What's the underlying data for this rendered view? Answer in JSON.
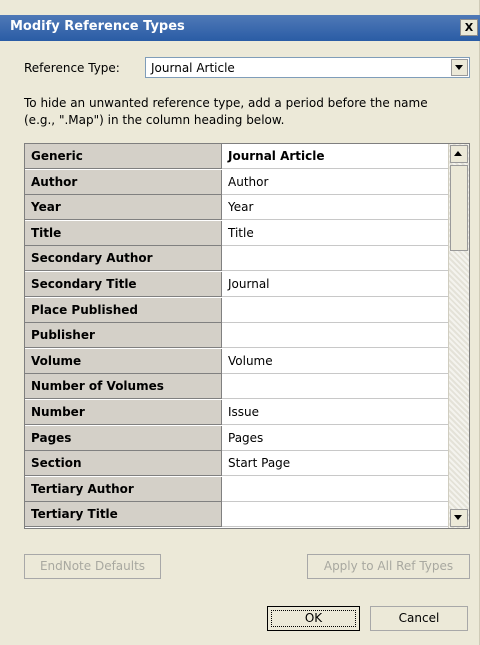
{
  "window": {
    "title": "Modify Reference Types",
    "close_glyph": "X"
  },
  "ref_type": {
    "label": "Reference Type:",
    "value": "Journal Article"
  },
  "instructions": {
    "line1": "To hide an unwanted reference type, add a period before the name",
    "line2": "(e.g., \".Map\") in the column heading below."
  },
  "table": {
    "rows": [
      {
        "field": "Generic",
        "value": "Journal Article"
      },
      {
        "field": "Author",
        "value": "Author"
      },
      {
        "field": "Year",
        "value": "Year"
      },
      {
        "field": "Title",
        "value": "Title"
      },
      {
        "field": "Secondary Author",
        "value": ""
      },
      {
        "field": "Secondary Title",
        "value": "Journal"
      },
      {
        "field": "Place Published",
        "value": ""
      },
      {
        "field": "Publisher",
        "value": ""
      },
      {
        "field": "Volume",
        "value": "Volume"
      },
      {
        "field": "Number of Volumes",
        "value": ""
      },
      {
        "field": "Number",
        "value": "Issue"
      },
      {
        "field": "Pages",
        "value": "Pages"
      },
      {
        "field": "Section",
        "value": "Start Page"
      },
      {
        "field": "Tertiary Author",
        "value": ""
      },
      {
        "field": "Tertiary Title",
        "value": ""
      }
    ]
  },
  "buttons": {
    "defaults": "EndNote Defaults",
    "apply_all": "Apply to All Ref Types",
    "ok": "OK",
    "cancel": "Cancel"
  },
  "icons": {
    "combo_arrow": "chevron-down-icon",
    "scroll_up": "arrow-up-icon",
    "scroll_down": "arrow-down-icon"
  }
}
